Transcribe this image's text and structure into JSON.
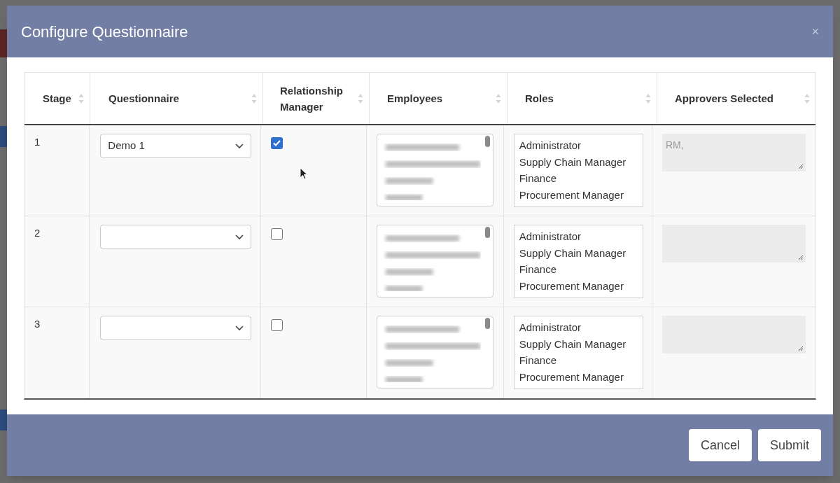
{
  "dialog": {
    "title": "Configure Questionnaire",
    "close": "×"
  },
  "table": {
    "columns": [
      {
        "label": "Stage"
      },
      {
        "label": "Questionnaire"
      },
      {
        "label": "Relationship Manager"
      },
      {
        "label": "Employees"
      },
      {
        "label": "Roles"
      },
      {
        "label": "Approvers Selected"
      }
    ],
    "rows": [
      {
        "stage": "1",
        "questionnaire": "Demo 1",
        "relationship_manager": true,
        "roles": [
          "Administrator",
          "Supply Chain Manager",
          "Finance",
          "Procurement Manager"
        ],
        "approvers": "RM,"
      },
      {
        "stage": "2",
        "questionnaire": "",
        "relationship_manager": false,
        "roles": [
          "Administrator",
          "Supply Chain Manager",
          "Finance",
          "Procurement Manager"
        ],
        "approvers": ""
      },
      {
        "stage": "3",
        "questionnaire": "",
        "relationship_manager": false,
        "roles": [
          "Administrator",
          "Supply Chain Manager",
          "Finance",
          "Procurement Manager"
        ],
        "approvers": ""
      }
    ]
  },
  "buttons": [
    {
      "label": "Cancel"
    },
    {
      "label": "Submit"
    }
  ]
}
